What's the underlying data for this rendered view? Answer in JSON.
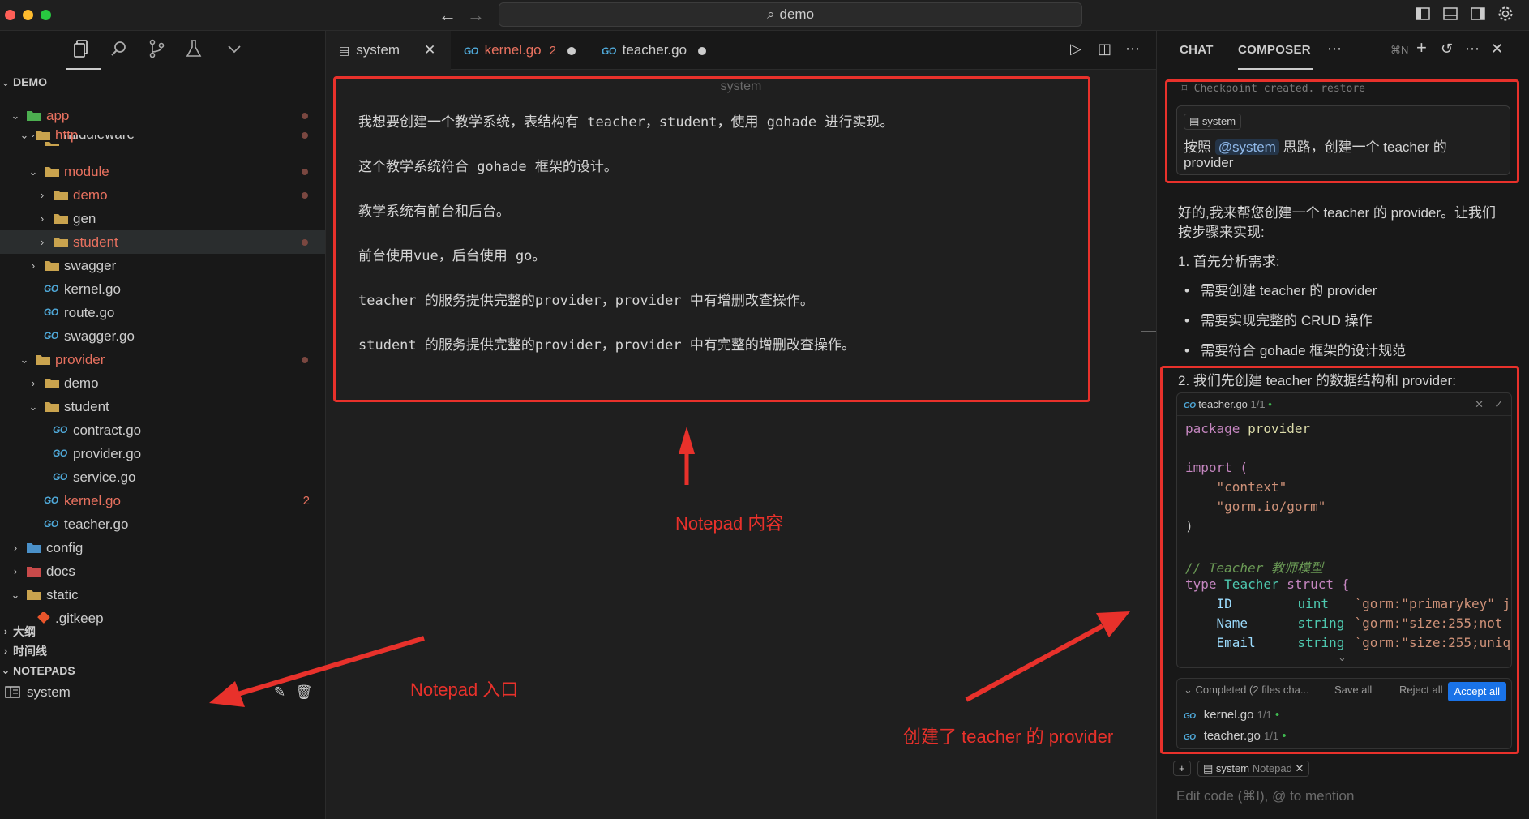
{
  "titlebar": {
    "search_text": "demo",
    "back_icon": "arrow-left-icon",
    "forward_icon": "arrow-right-icon"
  },
  "sidebar": {
    "root": "DEMO",
    "tree": [
      {
        "label": "app",
        "kind": "folder-app",
        "modified": true,
        "dot": true
      },
      {
        "label": "http",
        "kind": "folder",
        "modified": true,
        "dot": true
      },
      {
        "label": "middleware",
        "kind": "folder",
        "modified": false,
        "dot": false
      },
      {
        "label": "module",
        "kind": "folder",
        "modified": true,
        "dot": true
      },
      {
        "label": "demo",
        "kind": "folder",
        "modified": true,
        "dot": true
      },
      {
        "label": "gen",
        "kind": "folder",
        "modified": false,
        "dot": false
      },
      {
        "label": "student",
        "kind": "folder",
        "modified": true,
        "dot": true
      },
      {
        "label": "swagger",
        "kind": "folder",
        "modified": false,
        "dot": false
      },
      {
        "label": "kernel.go",
        "kind": "go",
        "modified": false,
        "dot": false
      },
      {
        "label": "route.go",
        "kind": "go",
        "modified": false,
        "dot": false
      },
      {
        "label": "swagger.go",
        "kind": "go",
        "modified": false,
        "dot": false
      },
      {
        "label": "provider",
        "kind": "folder",
        "modified": true,
        "dot": true
      },
      {
        "label": "demo",
        "kind": "folder",
        "modified": false,
        "dot": false
      },
      {
        "label": "student",
        "kind": "folder",
        "modified": false,
        "dot": false
      },
      {
        "label": "contract.go",
        "kind": "go",
        "modified": false,
        "dot": false
      },
      {
        "label": "provider.go",
        "kind": "go",
        "modified": false,
        "dot": false
      },
      {
        "label": "service.go",
        "kind": "go",
        "modified": false,
        "dot": false
      },
      {
        "label": "kernel.go",
        "kind": "go",
        "modified": true,
        "badge": "2"
      },
      {
        "label": "teacher.go",
        "kind": "go",
        "modified": false,
        "dot": false
      },
      {
        "label": "config",
        "kind": "folder-config",
        "modified": false,
        "dot": false
      },
      {
        "label": "docs",
        "kind": "folder-docs",
        "modified": false,
        "dot": false
      },
      {
        "label": "static",
        "kind": "folder",
        "modified": false,
        "dot": false
      },
      {
        "label": ".gitkeep",
        "kind": "git",
        "modified": false,
        "dot": false
      }
    ],
    "outline": "大纲",
    "timeline": "时间线",
    "notepads": "NOTEPADS",
    "notepad_item": "system"
  },
  "editor": {
    "tabs": [
      {
        "label": "system",
        "active": true
      },
      {
        "label": "kernel.go",
        "badge": "2",
        "modified": true
      },
      {
        "label": "teacher.go",
        "modified": true
      }
    ],
    "go_tag": "GO",
    "notepad_title": "system",
    "notepad_lines": [
      "我想要创建一个教学系统，表结构有 teacher，student，使用 gohade 进行实现。",
      "这个教学系统符合 gohade 框架的设计。",
      "教学系统有前台和后台。",
      "前台使用vue，后台使用 go。",
      "teacher 的服务提供完整的provider，provider 中有增删改查操作。",
      "student 的服务提供完整的provider，provider 中有完整的增删改查操作。"
    ]
  },
  "chat": {
    "tab_chat": "CHAT",
    "tab_composer": "COMPOSER",
    "shortcut": "⌘N",
    "checkpoint": "Checkpoint created.",
    "restore": "restore",
    "user_pill": "system",
    "user_text_1": "按照",
    "user_mention": "@system",
    "user_text_2": "思路，创建一个 teacher 的",
    "user_text_3": "provider",
    "reply_1": "好的,我来帮您创建一个 teacher 的 provider。让我们",
    "reply_2": "按步骤来实现:",
    "step_1": "1. 首先分析需求:",
    "bullets": [
      "需要创建 teacher 的 provider",
      "需要实现完整的 CRUD 操作",
      "需要符合 gohade 框架的设计规范"
    ],
    "step_2": "2. 我们先创建 teacher 的数据结构和 provider:",
    "code_file": "teacher.go",
    "code_count": "1/1",
    "code": {
      "package_kw": "package",
      "package_name": "provider",
      "import_kw": "import (",
      "imp1": "\"context\"",
      "imp2": "\"gorm.io/gorm\"",
      "close_paren": ")",
      "comment": "// Teacher 教师模型",
      "type_kw": "type",
      "type_name": "Teacher",
      "struct_kw": "struct {",
      "fields": [
        {
          "name": "ID",
          "type": "uint",
          "tag": "`gorm:\"primarykey\" j"
        },
        {
          "name": "Name",
          "type": "string",
          "tag": "`gorm:\"size:255;not"
        },
        {
          "name": "Email",
          "type": "string",
          "tag": "`gorm:\"size:255;uniq"
        }
      ]
    },
    "completed_label": "Completed (2 files cha...",
    "save_all": "Save all",
    "reject_all": "Reject all",
    "accept_all": "Accept all",
    "files": [
      {
        "name": "kernel.go",
        "count": "1/1"
      },
      {
        "name": "teacher.go",
        "count": "1/1"
      }
    ],
    "context_pill": "system",
    "context_type": "Notepad",
    "input_placeholder": "Edit code (⌘I), @ to mention"
  },
  "annotations": {
    "notepad_content": "Notepad 内容",
    "notepad_entry": "Notepad 入口",
    "created_provider": "创建了 teacher 的 provider"
  },
  "colors": {
    "accent": "#1a73e8",
    "modified": "#e8715f",
    "annotation": "#e8312b"
  }
}
